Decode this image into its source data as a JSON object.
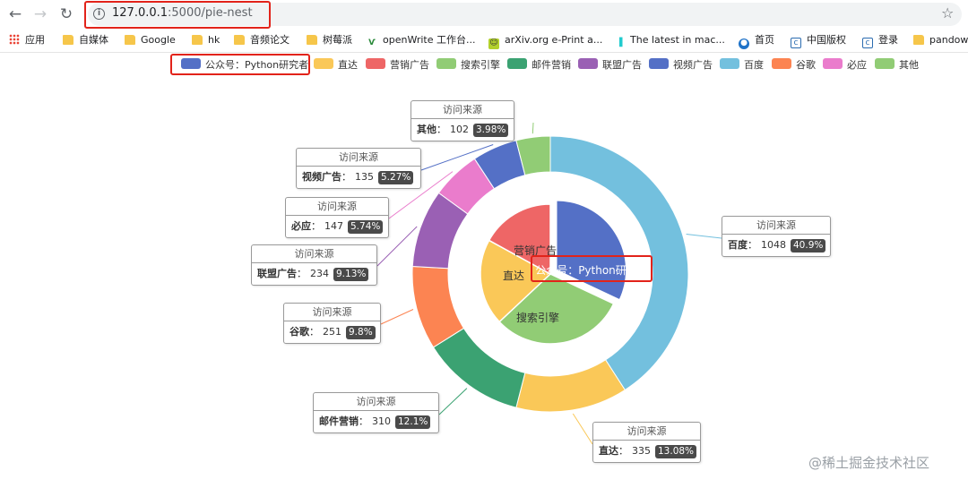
{
  "browser": {
    "url_host": "127.0.0.1",
    "url_path": ":5000/pie-nest",
    "bookmarks": [
      {
        "label": "应用",
        "icon": "apps-icon"
      },
      {
        "label": "自媒体",
        "icon": "folder-icon"
      },
      {
        "label": "Google",
        "icon": "folder-icon"
      },
      {
        "label": "hk",
        "icon": "folder-icon"
      },
      {
        "label": "音频论文",
        "icon": "folder-icon"
      },
      {
        "label": "树莓派",
        "icon": "folder-icon"
      },
      {
        "label": "openWrite 工作台...",
        "icon": "openwrite-icon"
      },
      {
        "label": "arXiv.org e-Print a...",
        "icon": "arxiv-icon"
      },
      {
        "label": "The latest in mac...",
        "icon": "paperswithcode-icon"
      },
      {
        "label": "首页",
        "icon": "site-icon"
      },
      {
        "label": "中国版权",
        "icon": "c-icon"
      },
      {
        "label": "登录",
        "icon": "c-icon"
      },
      {
        "label": "pandow",
        "icon": "folder-icon"
      }
    ]
  },
  "chart_data": {
    "type": "pie",
    "tooltip_title": "访问来源",
    "legend": [
      {
        "name": "公众号：Python研究者",
        "color": "#5470c6"
      },
      {
        "name": "直达",
        "color": "#fac858"
      },
      {
        "name": "营销广告",
        "color": "#ee6666"
      },
      {
        "name": "搜索引擎",
        "color": "#91cc75"
      },
      {
        "name": "邮件营销",
        "color": "#3ba272"
      },
      {
        "name": "联盟广告",
        "color": "#9a60b4"
      },
      {
        "name": "视频广告",
        "color": "#5470c6"
      },
      {
        "name": "百度",
        "color": "#73c0de"
      },
      {
        "name": "谷歌",
        "color": "#fc8452"
      },
      {
        "name": "必应",
        "color": "#ea7ccc"
      },
      {
        "name": "其他",
        "color": "#91cc75"
      }
    ],
    "inner_series": {
      "labels_shown": [
        "营销广告",
        "直达",
        "公众号：Python研究者",
        "搜索引擎"
      ],
      "items": [
        {
          "name": "公众号：Python研究者",
          "color": "#5470c6",
          "share": 0.32
        },
        {
          "name": "搜索引擎",
          "color": "#91cc75",
          "share": 0.31
        },
        {
          "name": "直达",
          "color": "#fac858",
          "share": 0.2
        },
        {
          "name": "营销广告",
          "color": "#ee6666",
          "share": 0.17
        }
      ]
    },
    "outer_series": [
      {
        "name": "百度",
        "value": 1048,
        "percent": "40.9%",
        "color": "#73c0de"
      },
      {
        "name": "直达",
        "value": 335,
        "percent": "13.08%",
        "color": "#fac858"
      },
      {
        "name": "邮件营销",
        "value": 310,
        "percent": "12.1%",
        "color": "#3ba272"
      },
      {
        "name": "谷歌",
        "value": 251,
        "percent": "9.8%",
        "color": "#fc8452"
      },
      {
        "name": "联盟广告",
        "value": 234,
        "percent": "9.13%",
        "color": "#9a60b4"
      },
      {
        "name": "必应",
        "value": 147,
        "percent": "5.74%",
        "color": "#ea7ccc"
      },
      {
        "name": "视频广告",
        "value": 135,
        "percent": "5.27%",
        "color": "#5470c6"
      },
      {
        "name": "其他",
        "value": 102,
        "percent": "3.98%",
        "color": "#91cc75"
      }
    ]
  },
  "watermark": "@稀土掘金技术社区"
}
